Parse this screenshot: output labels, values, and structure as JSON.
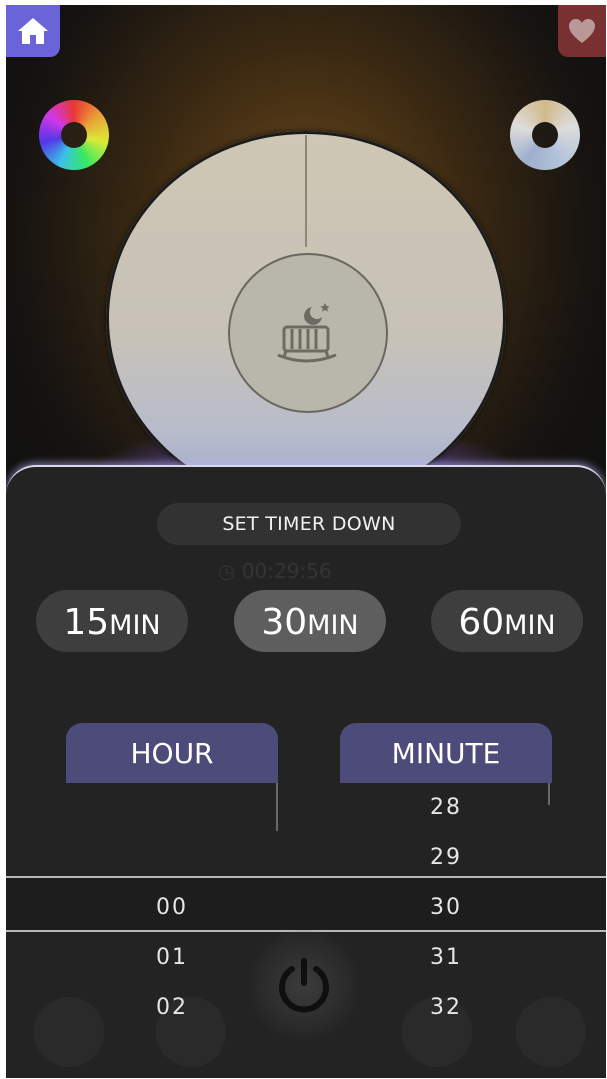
{
  "header": {
    "home_icon": "home-icon",
    "favorite_icon": "heart-icon"
  },
  "dial": {
    "center_icon": "crib-moon-icon"
  },
  "timer": {
    "title": "SET TIMER DOWN",
    "presets": [
      {
        "number": "15",
        "unit": "MIN",
        "active": false
      },
      {
        "number": "30",
        "unit": "MIN",
        "active": true
      },
      {
        "number": "60",
        "unit": "MIN",
        "active": false
      }
    ],
    "hour_label": "HOUR",
    "minute_label": "MINUTE",
    "hour_values": [
      "00",
      "01",
      "02"
    ],
    "minute_values": [
      "28",
      "29",
      "30",
      "31",
      "32"
    ],
    "selected_hour": "00",
    "selected_minute": "30"
  },
  "colors": {
    "accent": "#6b64d9",
    "column_header": "#4d4b7a",
    "sheet": "#232323"
  }
}
